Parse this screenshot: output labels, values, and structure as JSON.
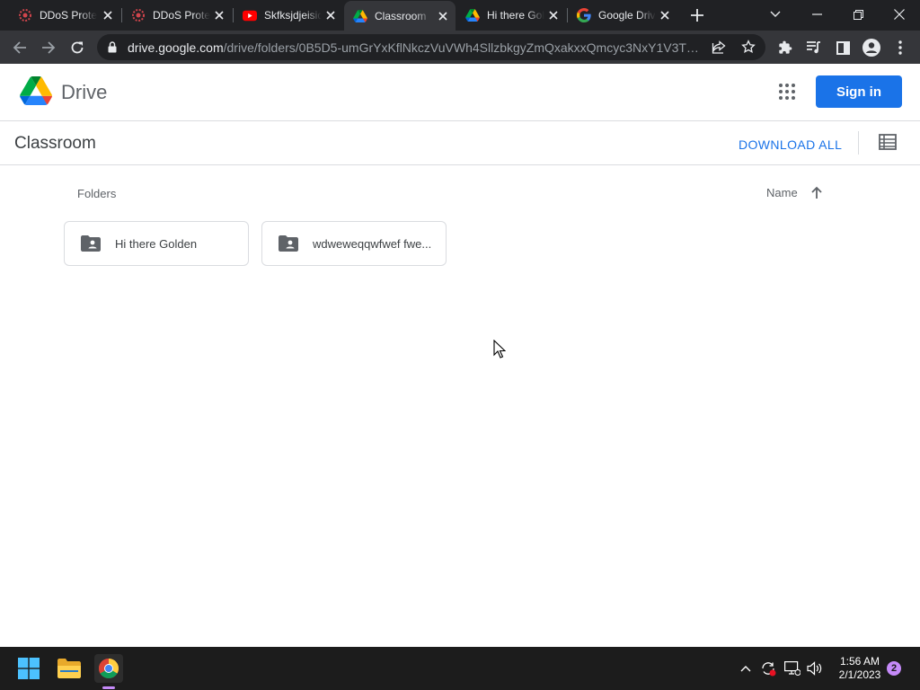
{
  "browser": {
    "tabs": [
      {
        "title": "DDoS Protection",
        "favicon": "ddos-icon"
      },
      {
        "title": "DDoS Protection",
        "favicon": "ddos-icon"
      },
      {
        "title": "Skfksjdjeisidk",
        "favicon": "youtube-icon"
      },
      {
        "title": "Classroom",
        "favicon": "drive-icon",
        "active": true
      },
      {
        "title": "Hi there Golden",
        "favicon": "drive-icon"
      },
      {
        "title": "Google Drive",
        "favicon": "google-icon"
      }
    ],
    "url_host": "drive.google.com",
    "url_path": "/drive/folders/0B5D5-umGrYxKflNkczVuVWh4SllzbkgyZmQxakxxQmcyc3NxY1V3TVk..."
  },
  "header": {
    "product_name": "Drive",
    "signin_label": "Sign in"
  },
  "folder": {
    "title": "Classroom",
    "download_all_label": "DOWNLOAD ALL",
    "section_label": "Folders",
    "sort_label": "Name",
    "items": [
      {
        "name": "Hi there Golden"
      },
      {
        "name": "wdweweqqwfwef fwe..."
      }
    ]
  },
  "taskbar": {
    "time": "1:56 AM",
    "date": "2/1/2023",
    "notification_count": "2"
  },
  "colors": {
    "accent": "#1a73e8",
    "chrome_dark": "#202124",
    "chrome_toolbar": "#35363a",
    "taskbar": "#1c1c1c"
  }
}
